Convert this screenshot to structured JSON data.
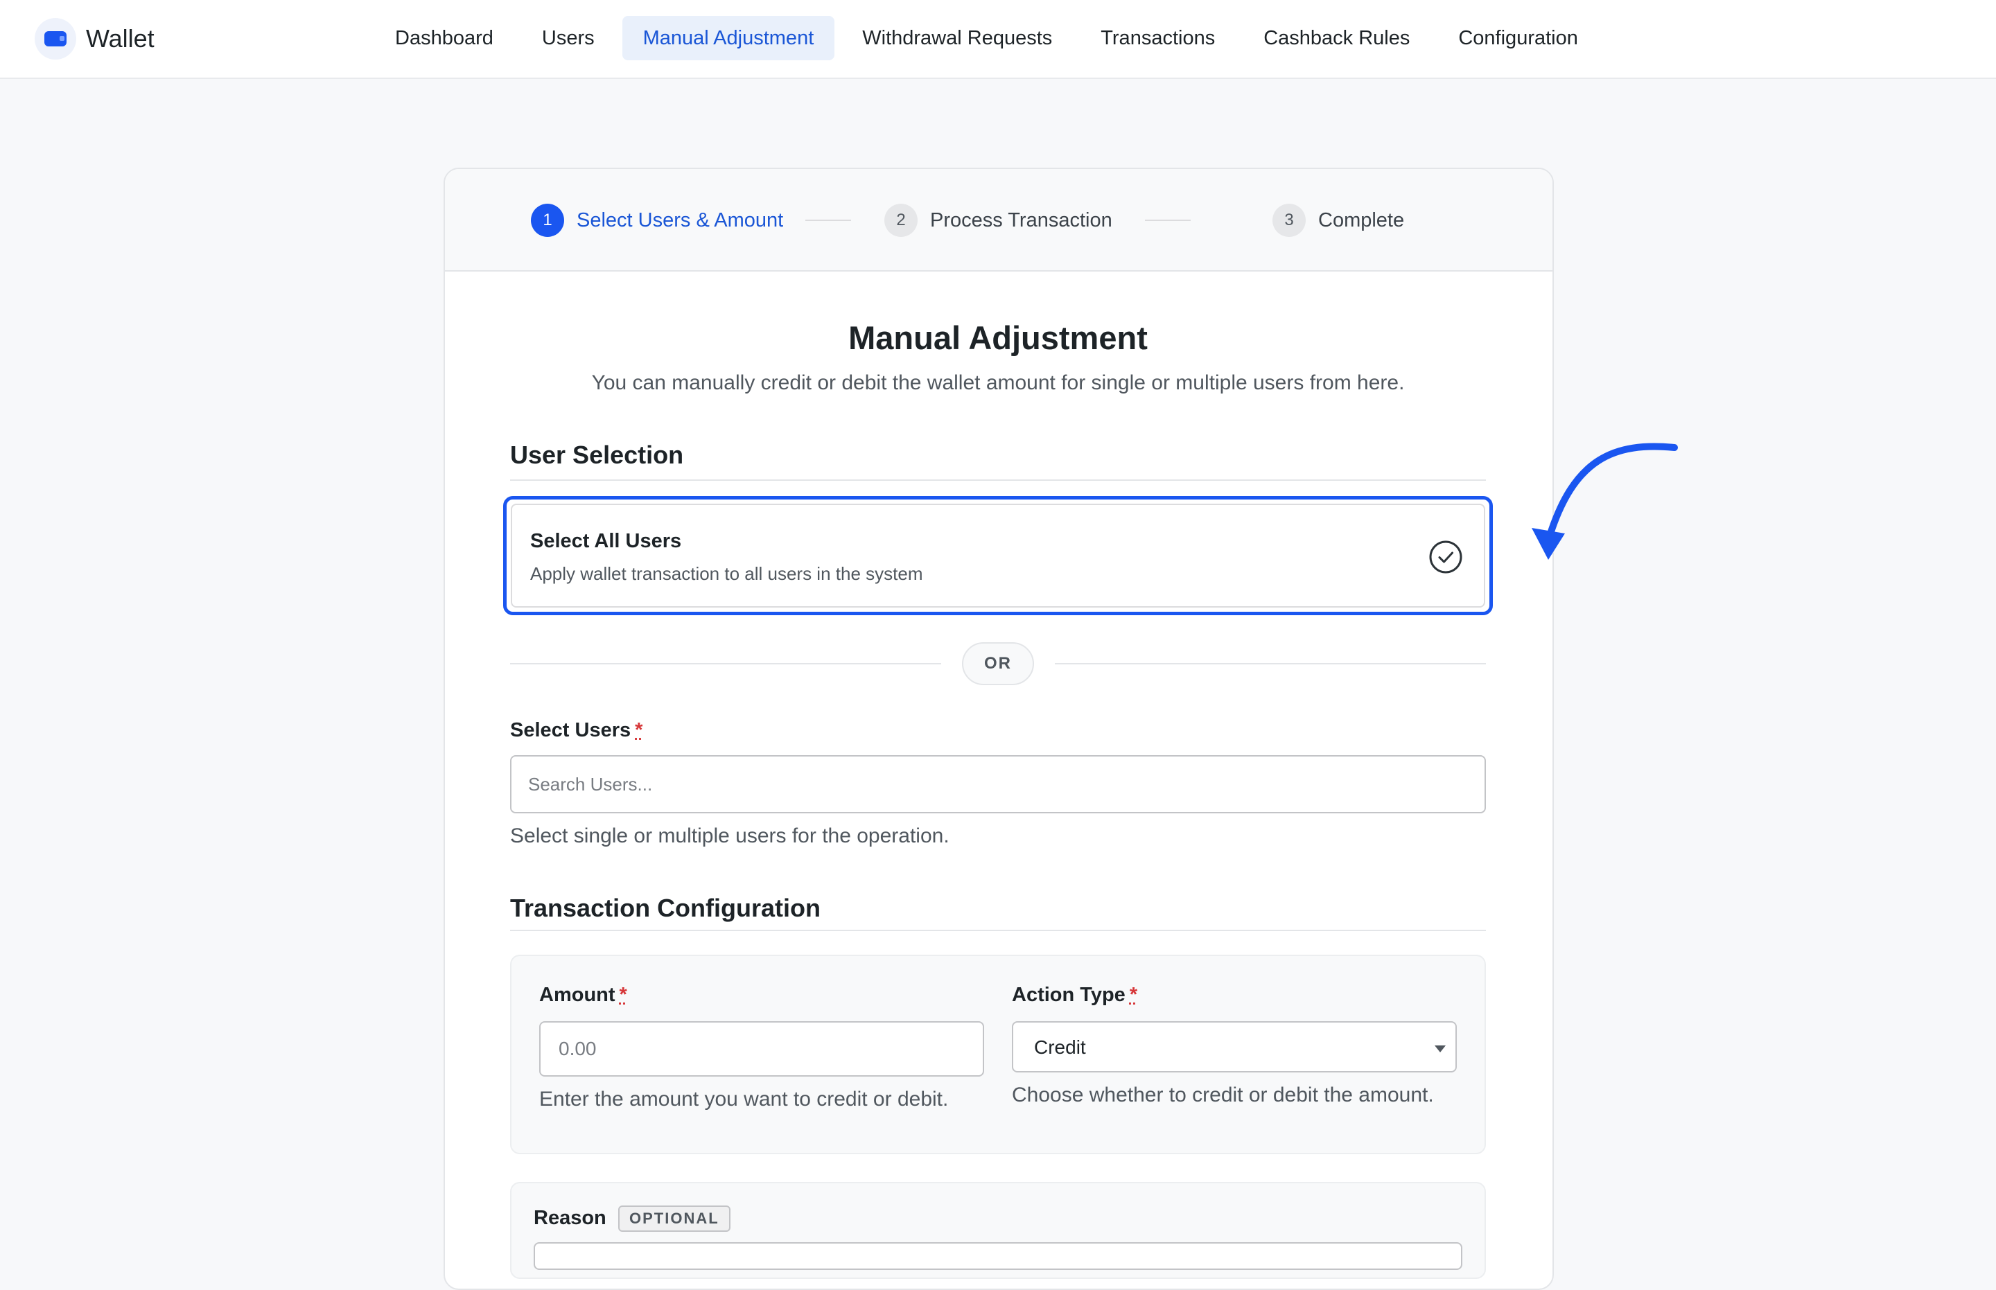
{
  "app": {
    "name": "Wallet"
  },
  "nav": {
    "items": [
      {
        "label": "Dashboard"
      },
      {
        "label": "Users"
      },
      {
        "label": "Manual Adjustment"
      },
      {
        "label": "Withdrawal Requests"
      },
      {
        "label": "Transactions"
      },
      {
        "label": "Cashback Rules"
      },
      {
        "label": "Configuration"
      }
    ],
    "active_index": 2
  },
  "stepper": {
    "steps": [
      {
        "number": "1",
        "label": "Select Users & Amount"
      },
      {
        "number": "2",
        "label": "Process Transaction"
      },
      {
        "number": "3",
        "label": "Complete"
      }
    ],
    "current_step": 1
  },
  "page": {
    "title": "Manual Adjustment",
    "subtitle": "You can manually credit or debit the wallet amount for single or multiple users from here."
  },
  "user_selection": {
    "heading": "User Selection",
    "select_all_title": "Select All Users",
    "select_all_description": "Apply wallet transaction to all users in the system",
    "or_label": "OR",
    "select_users_label": "Select Users",
    "required_mark": "*",
    "search_placeholder": "Search Users...",
    "search_value": "",
    "help": "Select single or multiple users for the operation."
  },
  "transaction_config": {
    "heading": "Transaction Configuration",
    "amount_label": "Amount",
    "amount_placeholder": "0.00",
    "amount_value": "",
    "amount_help": "Enter the amount you want to credit or debit.",
    "action_type_label": "Action Type",
    "action_type_value": "Credit",
    "action_type_help": "Choose whether to credit or debit the amount."
  },
  "reason": {
    "label": "Reason",
    "badge": "OPTIONAL"
  },
  "colors": {
    "accent": "#1a56f0",
    "required": "#d63638"
  },
  "icons": {
    "brand": "wallet-icon",
    "select_all": "check-circle-icon",
    "dropdown": "caret-down-icon",
    "annotation": "curved-arrow-icon"
  }
}
